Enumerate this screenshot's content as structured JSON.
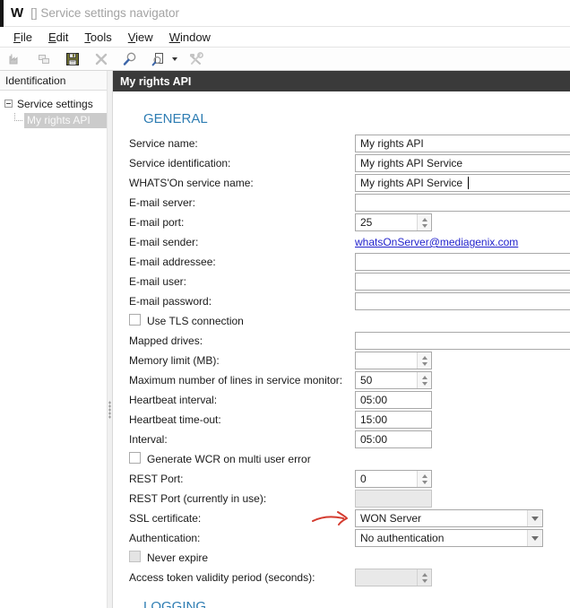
{
  "window": {
    "logo": "W",
    "title": "[] Service settings navigator"
  },
  "menu": {
    "items": [
      {
        "u": "F",
        "rest": "ile"
      },
      {
        "u": "E",
        "rest": "dit"
      },
      {
        "u": "T",
        "rest": "ools"
      },
      {
        "u": "V",
        "rest": "iew"
      },
      {
        "u": "W",
        "rest": "indow"
      }
    ]
  },
  "toolbar": {
    "icons": [
      "factory",
      "copy",
      "save",
      "delete",
      "search",
      "search-document",
      "tools"
    ]
  },
  "sidebar": {
    "header": "Identification",
    "root": "Service settings",
    "selected_item": "My rights API"
  },
  "content": {
    "header": "My rights API",
    "sections": {
      "general": "GENERAL",
      "logging": "LOGGING"
    },
    "colors": {
      "accent_blue": "#2e7db3",
      "link_blue": "#2222cc",
      "header_dark": "#3a3a3a",
      "arrow_red": "#d43b2f",
      "selected_tree_bg": "#cbcbcb"
    },
    "fields": [
      {
        "label": "Service name:",
        "value": "My rights API",
        "type": "text"
      },
      {
        "label": "Service identification:",
        "value": "My rights API Service",
        "type": "text"
      },
      {
        "label": "WHATS'On service name:",
        "value": "My rights API Service",
        "type": "text-caret"
      },
      {
        "label": "E-mail server:",
        "value": "",
        "type": "text"
      },
      {
        "label": "E-mail port:",
        "value": "25",
        "type": "spin"
      },
      {
        "label": "E-mail sender:",
        "value": "whatsOnServer@mediagenix.com",
        "type": "link"
      },
      {
        "label": "E-mail addressee:",
        "value": "",
        "type": "text"
      },
      {
        "label": "E-mail user:",
        "value": "",
        "type": "text"
      },
      {
        "label": "E-mail password:",
        "value": "",
        "type": "text"
      },
      {
        "label": "Use TLS connection",
        "checked": false,
        "type": "checkbox"
      },
      {
        "label": "Mapped drives:",
        "value": "",
        "type": "text"
      },
      {
        "label": "Memory limit (MB):",
        "value": "",
        "type": "spin"
      },
      {
        "label": "Maximum number of lines in service monitor:",
        "value": "50",
        "type": "spin"
      },
      {
        "label": "Heartbeat interval:",
        "value": "05:00",
        "type": "small"
      },
      {
        "label": "Heartbeat time-out:",
        "value": "15:00",
        "type": "small"
      },
      {
        "label": "Interval:",
        "value": "05:00",
        "type": "small"
      },
      {
        "label": "Generate WCR on multi user error",
        "checked": false,
        "type": "checkbox"
      },
      {
        "label": "REST Port:",
        "value": "0",
        "type": "spin"
      },
      {
        "label": "REST Port (currently in use):",
        "value": "",
        "type": "small-disabled"
      },
      {
        "label": "SSL certificate:",
        "value": "WON Server",
        "type": "combo",
        "annotation": "red-arrow"
      },
      {
        "label": "Authentication:",
        "value": "No authentication",
        "type": "combo"
      },
      {
        "label": "Never expire",
        "checked": false,
        "type": "checkbox-disabled"
      },
      {
        "label": "Access token validity period (seconds):",
        "value": "",
        "type": "spin-disabled"
      }
    ]
  }
}
